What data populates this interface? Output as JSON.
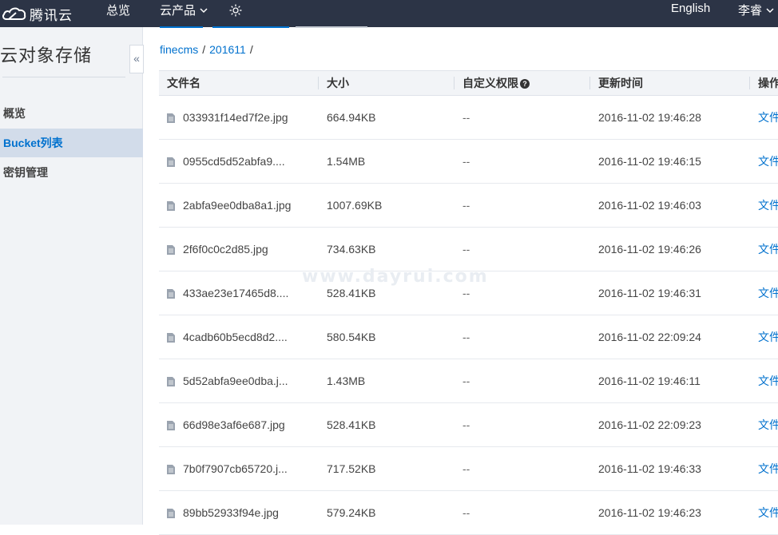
{
  "header": {
    "brand": "腾讯云",
    "nav_overview": "总览",
    "nav_products": "云产品",
    "language": "English",
    "user": "李睿"
  },
  "sidebar": {
    "title": "云对象存储",
    "collapse_glyph": "«",
    "items": [
      {
        "label": "概览",
        "active": false
      },
      {
        "label": "Bucket列表",
        "active": true
      },
      {
        "label": "密钥管理",
        "active": false
      }
    ]
  },
  "breadcrumb": {
    "bucket": "finecms",
    "folder": "201611",
    "sep": "/"
  },
  "table": {
    "columns": {
      "name": "文件名",
      "size": "大小",
      "acl": "自定义权限",
      "updated": "更新时间",
      "ops": "操作"
    },
    "help_glyph": "?",
    "rows": [
      {
        "name": "033931f14ed7f2e.jpg",
        "size": "664.94KB",
        "acl": "--",
        "updated": "2016-11-02 19:46:28",
        "op": "文件"
      },
      {
        "name": "0955cd5d52abfa9....",
        "size": "1.54MB",
        "acl": "--",
        "updated": "2016-11-02 19:46:15",
        "op": "文件"
      },
      {
        "name": "2abfa9ee0dba8a1.jpg",
        "size": "1007.69KB",
        "acl": "--",
        "updated": "2016-11-02 19:46:03",
        "op": "文件"
      },
      {
        "name": "2f6f0c0c2d85.jpg",
        "size": "734.63KB",
        "acl": "--",
        "updated": "2016-11-02 19:46:26",
        "op": "文件"
      },
      {
        "name": "433ae23e17465d8....",
        "size": "528.41KB",
        "acl": "--",
        "updated": "2016-11-02 19:46:31",
        "op": "文件"
      },
      {
        "name": "4cadb60b5ecd8d2....",
        "size": "580.54KB",
        "acl": "--",
        "updated": "2016-11-02 22:09:24",
        "op": "文件"
      },
      {
        "name": "5d52abfa9ee0dba.j...",
        "size": "1.43MB",
        "acl": "--",
        "updated": "2016-11-02 19:46:11",
        "op": "文件"
      },
      {
        "name": "66d98e3af6e687.jpg",
        "size": "528.41KB",
        "acl": "--",
        "updated": "2016-11-02 22:09:23",
        "op": "文件"
      },
      {
        "name": "7b0f7907cb65720.j...",
        "size": "717.52KB",
        "acl": "--",
        "updated": "2016-11-02 19:46:33",
        "op": "文件"
      },
      {
        "name": "89bb52933f94e.jpg",
        "size": "579.24KB",
        "acl": "--",
        "updated": "2016-11-02 19:46:23",
        "op": "文件"
      }
    ]
  },
  "watermark": "www.dayrui.com",
  "colors": {
    "topbar": "#2c3446",
    "sidebar_bg": "#f1f3f6",
    "active_item_bg": "#d2dcea",
    "link": "#0071ce"
  },
  "icons": {
    "logo": "tencent-cloud-logo-icon",
    "settings": "settings-icon",
    "caret": "chevron-down-icon",
    "file": "file-icon"
  }
}
